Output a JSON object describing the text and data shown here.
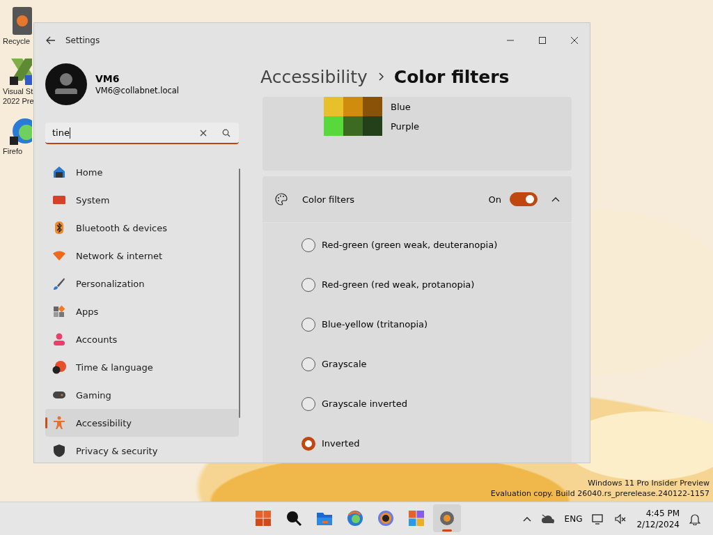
{
  "desktop_icons": [
    {
      "kind": "recycle",
      "lines": [
        "Recycle"
      ]
    },
    {
      "kind": "studio",
      "lines": [
        "Visual St",
        "2022 Pre"
      ]
    },
    {
      "kind": "browser",
      "lines": [
        "Firefo"
      ]
    }
  ],
  "window": {
    "title": "Settings"
  },
  "account": {
    "name": "VM6",
    "email": "VM6@collabnet.local"
  },
  "search": {
    "value": "tine"
  },
  "nav": [
    {
      "kind": "home",
      "label": "Home",
      "selected": false
    },
    {
      "kind": "system",
      "label": "System",
      "selected": false
    },
    {
      "kind": "bluetooth",
      "label": "Bluetooth & devices",
      "selected": false
    },
    {
      "kind": "network",
      "label": "Network & internet",
      "selected": false
    },
    {
      "kind": "personalization",
      "label": "Personalization",
      "selected": false
    },
    {
      "kind": "apps",
      "label": "Apps",
      "selected": false
    },
    {
      "kind": "accounts",
      "label": "Accounts",
      "selected": false
    },
    {
      "kind": "time",
      "label": "Time & language",
      "selected": false
    },
    {
      "kind": "gaming",
      "label": "Gaming",
      "selected": false
    },
    {
      "kind": "accessibility",
      "label": "Accessibility",
      "selected": true
    },
    {
      "kind": "privacy",
      "label": "Privacy & security",
      "selected": false
    }
  ],
  "breadcrumb": [
    "Accessibility",
    "Color filters"
  ],
  "swatch_rows": [
    {
      "label": "Blue",
      "swatches": [
        {
          "color": "#e8c02a"
        },
        {
          "color": "#d08c0c"
        },
        {
          "color": "#8a5208"
        }
      ]
    },
    {
      "label": "Purple",
      "swatches": [
        {
          "color": "#58d83a"
        },
        {
          "color": "#3c6a22"
        },
        {
          "color": "#24401a"
        }
      ]
    }
  ],
  "color_filters": {
    "label": "Color filters",
    "state_text": "On",
    "on": true,
    "expanded": true,
    "options": [
      {
        "label": "Red-green (green weak, deuteranopia)",
        "selected": false
      },
      {
        "label": "Red-green (red weak, protanopia)",
        "selected": false
      },
      {
        "label": "Blue-yellow (tritanopia)",
        "selected": false
      },
      {
        "label": "Grayscale",
        "selected": false
      },
      {
        "label": "Grayscale inverted",
        "selected": false
      },
      {
        "label": "Inverted",
        "selected": true
      }
    ]
  },
  "watermark": [
    "Windows 11 Pro Insider Preview",
    "Evaluation copy. Build 26040.rs_prerelease.240122-1157"
  ],
  "taskbar": {
    "apps": [
      {
        "kind": "start",
        "active": false
      },
      {
        "kind": "search",
        "active": false
      },
      {
        "kind": "folder",
        "active": false
      },
      {
        "kind": "browser",
        "active": false
      },
      {
        "kind": "ring",
        "active": false
      },
      {
        "kind": "store",
        "active": false
      },
      {
        "kind": "settings",
        "active": true
      }
    ],
    "language": "ENG",
    "time": "4:45 PM",
    "date": "2/12/2024"
  }
}
